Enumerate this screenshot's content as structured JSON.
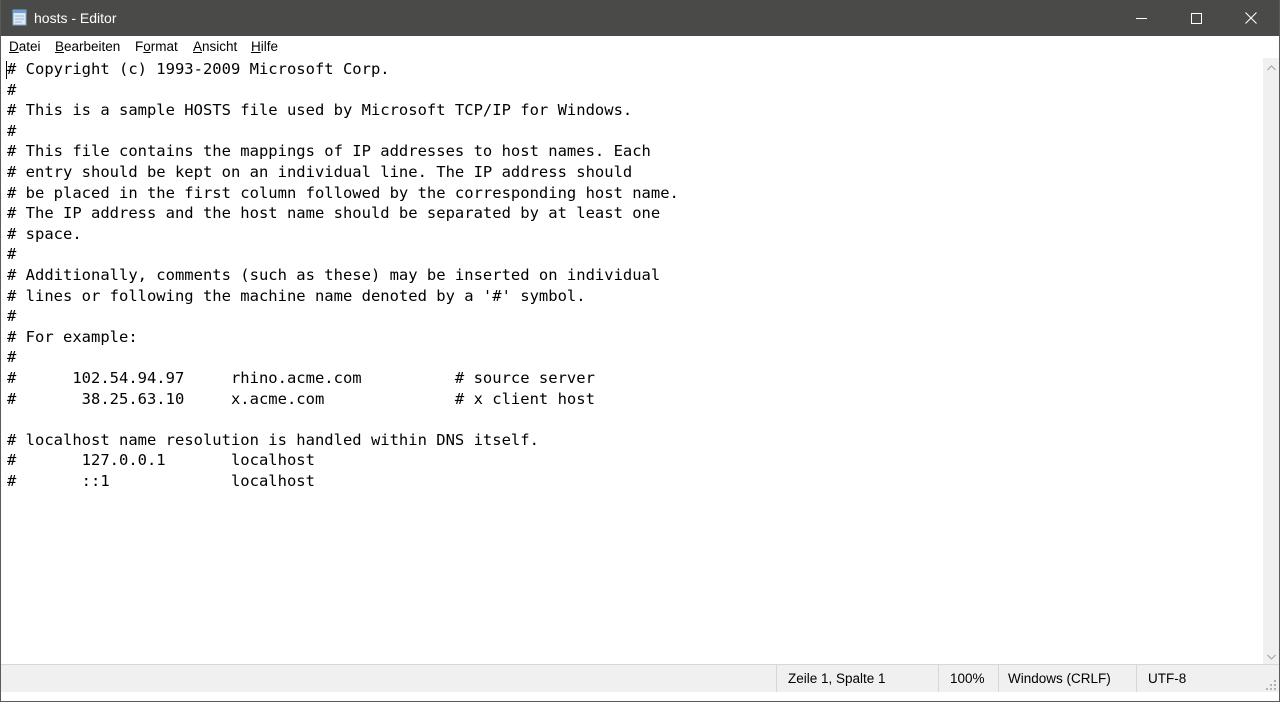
{
  "window": {
    "title": "hosts - Editor"
  },
  "menu": {
    "datei": {
      "hotkey": "D",
      "rest": "atei"
    },
    "bearbeiten": {
      "hotkey": "B",
      "rest": "earbeiten"
    },
    "format": {
      "first": "F",
      "hotkey": "o",
      "rest": "rmat"
    },
    "ansicht": {
      "hotkey": "A",
      "rest": "nsicht"
    },
    "hilfe": {
      "hotkey": "H",
      "rest": "ilfe"
    }
  },
  "editor": {
    "content": "# Copyright (c) 1993-2009 Microsoft Corp.\n#\n# This is a sample HOSTS file used by Microsoft TCP/IP for Windows.\n#\n# This file contains the mappings of IP addresses to host names. Each\n# entry should be kept on an individual line. The IP address should\n# be placed in the first column followed by the corresponding host name.\n# The IP address and the host name should be separated by at least one\n# space.\n#\n# Additionally, comments (such as these) may be inserted on individual\n# lines or following the machine name denoted by a '#' symbol.\n#\n# For example:\n#\n#      102.54.94.97     rhino.acme.com          # source server\n#       38.25.63.10     x.acme.com              # x client host\n\n# localhost name resolution is handled within DNS itself.\n#\t127.0.0.1       localhost\n#\t::1             localhost"
  },
  "status": {
    "position": "Zeile 1, Spalte 1",
    "zoom": "100%",
    "line_ending": "Windows (CRLF)",
    "encoding": "UTF-8"
  },
  "icons": {
    "app": "notepad-icon",
    "minimize": "minimize-icon",
    "maximize": "maximize-icon",
    "close": "close-icon"
  },
  "colors": {
    "titlebar": "#4a4a48",
    "statusbar": "#f0f0f0",
    "text": "#000000"
  }
}
